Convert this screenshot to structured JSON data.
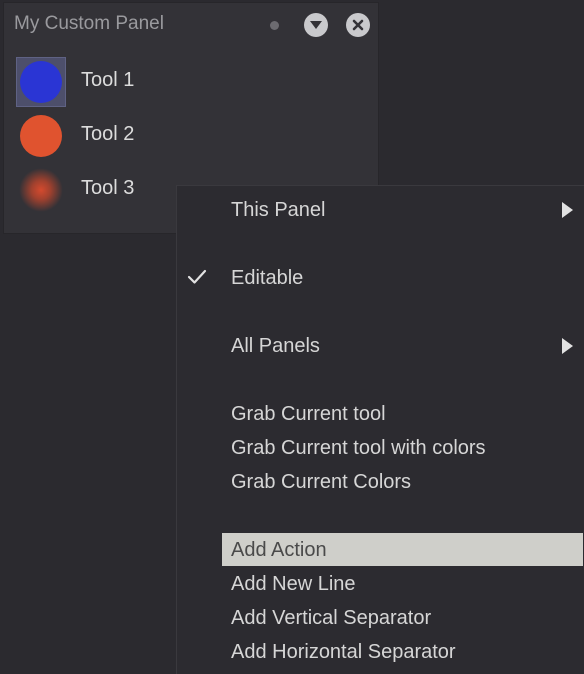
{
  "panel": {
    "title": "My Custom Panel",
    "header_icons": [
      "status-dot-icon",
      "dropdown-icon",
      "close-icon"
    ],
    "tools": [
      {
        "label": "Tool 1",
        "color": "#2a35d4",
        "icon": "solid-brush-icon",
        "selected": true
      },
      {
        "label": "Tool 2",
        "color": "#e0532f",
        "icon": "solid-brush-icon",
        "selected": false
      },
      {
        "label": "Tool 3",
        "color": "#c7462b",
        "icon": "soft-brush-icon",
        "selected": false
      }
    ]
  },
  "context_menu": {
    "items": [
      {
        "label": "This Panel",
        "submenu": true
      },
      {
        "label": "Editable",
        "checked": true
      },
      {
        "label": "All Panels",
        "submenu": true
      },
      {
        "label": "Grab Current tool"
      },
      {
        "label": "Grab Current tool with colors"
      },
      {
        "label": "Grab Current Colors"
      },
      {
        "label": "Add Action",
        "highlighted": true
      },
      {
        "label": "Add New Line"
      },
      {
        "label": "Add Vertical Separator"
      },
      {
        "label": "Add Horizontal Separator"
      }
    ]
  },
  "colors": {
    "background": "#2b2a2f",
    "panel_background": "#333237",
    "menu_background": "#2c2b30",
    "highlight": "#cfcfca",
    "selection": "#4d4f6b"
  }
}
